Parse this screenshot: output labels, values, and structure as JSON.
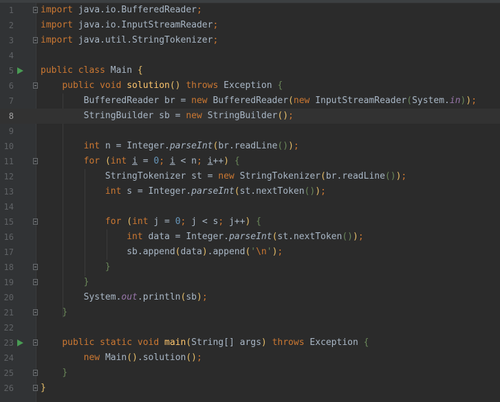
{
  "editor": {
    "current_line": 8,
    "colors": {
      "background": "#2b2b2b",
      "gutter": "#313335",
      "keyword": "#cc7832",
      "method": "#ffc66d",
      "number": "#6897bb",
      "string": "#6a8759",
      "static_field": "#9876aa",
      "text": "#a9b7c6",
      "run_icon": "#499c54"
    },
    "lines": [
      {
        "no": "1",
        "fold": "open",
        "tokens": [
          [
            "k",
            "import"
          ],
          [
            "p",
            " java.io.BufferedReader"
          ],
          [
            "k",
            ";"
          ]
        ]
      },
      {
        "no": "2",
        "tokens": [
          [
            "k",
            "import"
          ],
          [
            "p",
            " java.io.InputStreamReader"
          ],
          [
            "k",
            ";"
          ]
        ]
      },
      {
        "no": "3",
        "fold": "end",
        "tokens": [
          [
            "k",
            "import"
          ],
          [
            "p",
            " java.util.StringTokenizer"
          ],
          [
            "k",
            ";"
          ]
        ]
      },
      {
        "no": "4",
        "tokens": []
      },
      {
        "no": "5",
        "run": true,
        "tokens": [
          [
            "k",
            "public class "
          ],
          [
            "p",
            "Main "
          ],
          [
            "y",
            "{"
          ]
        ]
      },
      {
        "no": "6",
        "fold": "open",
        "tokens": [
          [
            "p",
            "    "
          ],
          [
            "k",
            "public void "
          ],
          [
            "m",
            "solution"
          ],
          [
            "y",
            "()"
          ],
          [
            "p",
            " "
          ],
          [
            "k",
            "throws "
          ],
          [
            "p",
            "Exception "
          ],
          [
            "s",
            "{"
          ]
        ]
      },
      {
        "no": "7",
        "tokens": [
          [
            "p",
            "        BufferedReader br = "
          ],
          [
            "k",
            "new "
          ],
          [
            "p",
            "BufferedReader"
          ],
          [
            "y",
            "("
          ],
          [
            "k",
            "new "
          ],
          [
            "p",
            "InputStreamReader"
          ],
          [
            "s",
            "("
          ],
          [
            "p",
            "System."
          ],
          [
            "sf",
            "in"
          ],
          [
            "s",
            ")"
          ],
          [
            "y",
            ")"
          ],
          [
            "k",
            ";"
          ]
        ]
      },
      {
        "no": "8",
        "tokens": [
          [
            "p",
            "        StringBuilder sb = "
          ],
          [
            "k",
            "new "
          ],
          [
            "p",
            "StringBuilder"
          ],
          [
            "y",
            "()"
          ],
          [
            "k",
            ";"
          ]
        ]
      },
      {
        "no": "9",
        "tokens": []
      },
      {
        "no": "10",
        "tokens": [
          [
            "p",
            "        "
          ],
          [
            "k",
            "int "
          ],
          [
            "p",
            "n = Integer."
          ],
          [
            "it",
            "parseInt"
          ],
          [
            "y",
            "("
          ],
          [
            "p",
            "br.readLine"
          ],
          [
            "s",
            "()"
          ],
          [
            "y",
            ")"
          ],
          [
            "k",
            ";"
          ]
        ]
      },
      {
        "no": "11",
        "fold": "open",
        "tokens": [
          [
            "p",
            "        "
          ],
          [
            "k",
            "for "
          ],
          [
            "y",
            "("
          ],
          [
            "k",
            "int "
          ],
          [
            "u",
            "i"
          ],
          [
            "p",
            " = "
          ],
          [
            "n",
            "0"
          ],
          [
            "k",
            "; "
          ],
          [
            "u",
            "i"
          ],
          [
            "p",
            " < n"
          ],
          [
            "k",
            "; "
          ],
          [
            "u",
            "i"
          ],
          [
            "p",
            "++"
          ],
          [
            "y",
            ")"
          ],
          [
            "p",
            " "
          ],
          [
            "s",
            "{"
          ]
        ]
      },
      {
        "no": "12",
        "tokens": [
          [
            "p",
            "            StringTokenizer st = "
          ],
          [
            "k",
            "new "
          ],
          [
            "p",
            "StringTokenizer"
          ],
          [
            "y",
            "("
          ],
          [
            "p",
            "br.readLine"
          ],
          [
            "s",
            "()"
          ],
          [
            "y",
            ")"
          ],
          [
            "k",
            ";"
          ]
        ]
      },
      {
        "no": "13",
        "tokens": [
          [
            "p",
            "            "
          ],
          [
            "k",
            "int "
          ],
          [
            "p",
            "s = Integer."
          ],
          [
            "it",
            "parseInt"
          ],
          [
            "y",
            "("
          ],
          [
            "p",
            "st.nextToken"
          ],
          [
            "s",
            "()"
          ],
          [
            "y",
            ")"
          ],
          [
            "k",
            ";"
          ]
        ]
      },
      {
        "no": "14",
        "tokens": []
      },
      {
        "no": "15",
        "fold": "open",
        "tokens": [
          [
            "p",
            "            "
          ],
          [
            "k",
            "for "
          ],
          [
            "y",
            "("
          ],
          [
            "k",
            "int "
          ],
          [
            "p",
            "j = "
          ],
          [
            "n",
            "0"
          ],
          [
            "k",
            "; "
          ],
          [
            "p",
            "j < s"
          ],
          [
            "k",
            "; "
          ],
          [
            "p",
            "j++"
          ],
          [
            "y",
            ")"
          ],
          [
            "p",
            " "
          ],
          [
            "s",
            "{"
          ]
        ]
      },
      {
        "no": "16",
        "tokens": [
          [
            "p",
            "                "
          ],
          [
            "k",
            "int "
          ],
          [
            "p",
            "data = Integer."
          ],
          [
            "it",
            "parseInt"
          ],
          [
            "y",
            "("
          ],
          [
            "p",
            "st.nextToken"
          ],
          [
            "s",
            "()"
          ],
          [
            "y",
            ")"
          ],
          [
            "k",
            ";"
          ]
        ]
      },
      {
        "no": "17",
        "tokens": [
          [
            "p",
            "                sb.append"
          ],
          [
            "y",
            "("
          ],
          [
            "p",
            "data"
          ],
          [
            "y",
            ")"
          ],
          [
            "p",
            ".append"
          ],
          [
            "y",
            "("
          ],
          [
            "s",
            "'"
          ],
          [
            "k",
            "\\n"
          ],
          [
            "s",
            "'"
          ],
          [
            "y",
            ")"
          ],
          [
            "k",
            ";"
          ]
        ]
      },
      {
        "no": "18",
        "fold": "end",
        "tokens": [
          [
            "p",
            "            "
          ],
          [
            "s",
            "}"
          ]
        ]
      },
      {
        "no": "19",
        "fold": "end",
        "tokens": [
          [
            "p",
            "        "
          ],
          [
            "s",
            "}"
          ]
        ]
      },
      {
        "no": "20",
        "tokens": [
          [
            "p",
            "        System."
          ],
          [
            "sf",
            "out"
          ],
          [
            "p",
            ".println"
          ],
          [
            "y",
            "("
          ],
          [
            "p",
            "sb"
          ],
          [
            "y",
            ")"
          ],
          [
            "k",
            ";"
          ]
        ]
      },
      {
        "no": "21",
        "fold": "end",
        "tokens": [
          [
            "p",
            "    "
          ],
          [
            "s",
            "}"
          ]
        ]
      },
      {
        "no": "22",
        "tokens": []
      },
      {
        "no": "23",
        "run": true,
        "fold": "open",
        "tokens": [
          [
            "p",
            "    "
          ],
          [
            "k",
            "public static void "
          ],
          [
            "m",
            "main"
          ],
          [
            "y",
            "("
          ],
          [
            "p",
            "String[] args"
          ],
          [
            "y",
            ")"
          ],
          [
            "p",
            " "
          ],
          [
            "k",
            "throws "
          ],
          [
            "p",
            "Exception "
          ],
          [
            "s",
            "{"
          ]
        ]
      },
      {
        "no": "24",
        "tokens": [
          [
            "p",
            "        "
          ],
          [
            "k",
            "new "
          ],
          [
            "p",
            "Main"
          ],
          [
            "y",
            "()"
          ],
          [
            "p",
            ".solution"
          ],
          [
            "y",
            "()"
          ],
          [
            "k",
            ";"
          ]
        ]
      },
      {
        "no": "25",
        "fold": "end",
        "tokens": [
          [
            "p",
            "    "
          ],
          [
            "s",
            "}"
          ]
        ]
      },
      {
        "no": "26",
        "fold": "end",
        "tokens": [
          [
            "y",
            "}"
          ]
        ]
      }
    ]
  }
}
